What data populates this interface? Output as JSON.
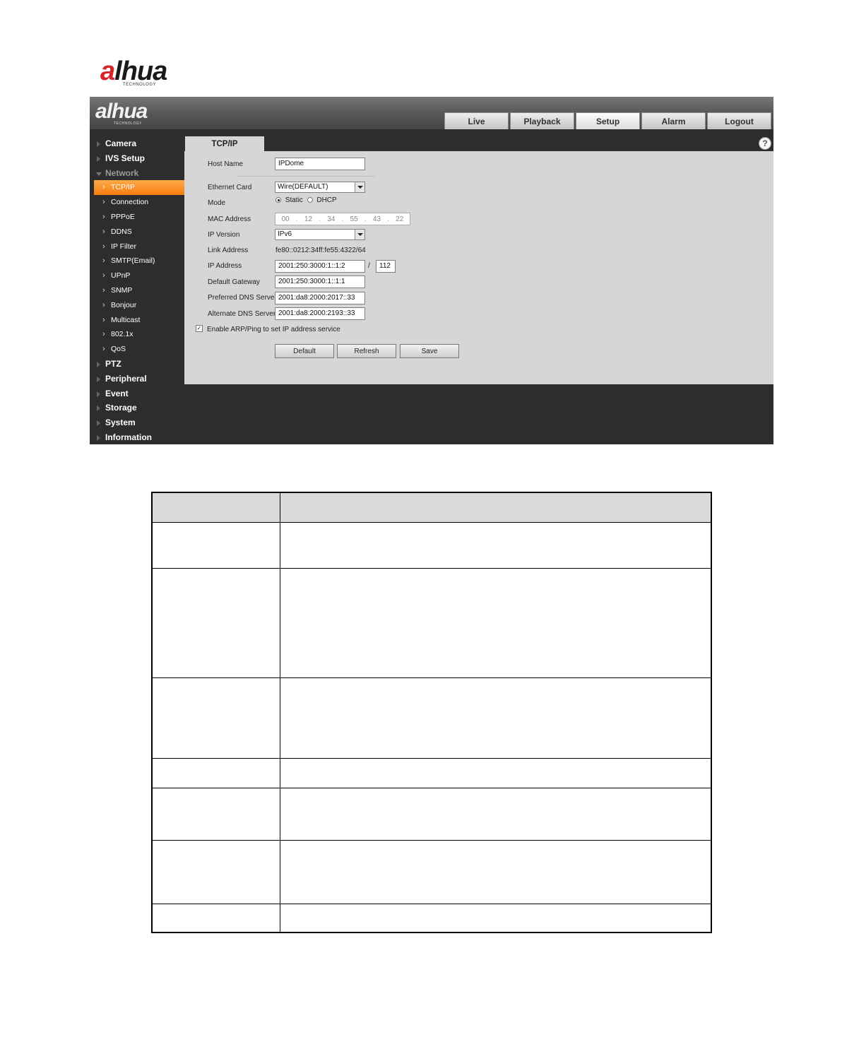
{
  "brand": {
    "name_prefix": "a",
    "name_rest": "lhua",
    "sub": "TECHNOLOGY"
  },
  "top_nav": {
    "tabs": [
      {
        "label": "Live"
      },
      {
        "label": "Playback"
      },
      {
        "label": "Setup"
      },
      {
        "label": "Alarm"
      },
      {
        "label": "Logout"
      }
    ],
    "active": "Setup"
  },
  "sidebar": {
    "items": [
      {
        "label": "Camera"
      },
      {
        "label": "IVS Setup"
      },
      {
        "label": "Network"
      },
      {
        "label": "PTZ"
      },
      {
        "label": "Peripheral"
      },
      {
        "label": "Event"
      },
      {
        "label": "Storage"
      },
      {
        "label": "System"
      },
      {
        "label": "Information"
      }
    ],
    "network_sub": [
      {
        "label": "TCP/IP"
      },
      {
        "label": "Connection"
      },
      {
        "label": "PPPoE"
      },
      {
        "label": "DDNS"
      },
      {
        "label": "IP Filter"
      },
      {
        "label": "SMTP(Email)"
      },
      {
        "label": "UPnP"
      },
      {
        "label": "SNMP"
      },
      {
        "label": "Bonjour"
      },
      {
        "label": "Multicast"
      },
      {
        "label": "802.1x"
      },
      {
        "label": "QoS"
      }
    ]
  },
  "content": {
    "tab": "TCP/IP",
    "help": "?",
    "form": {
      "host_name_label": "Host Name",
      "host_name_value": "IPDome",
      "ethernet_card_label": "Ethernet Card",
      "ethernet_card_value": "Wire(DEFAULT)",
      "mode_label": "Mode",
      "mode_static": "Static",
      "mode_dhcp": "DHCP",
      "mac_label": "MAC Address",
      "mac_parts": [
        "00",
        "12",
        "34",
        "55",
        "43",
        "22"
      ],
      "ip_version_label": "IP Version",
      "ip_version_value": "IPv6",
      "link_address_label": "Link Address",
      "link_address_value": "fe80::0212:34ff:fe55:4322/64",
      "ip_address_label": "IP Address",
      "ip_address_value": "2001:250:3000:1::1:2",
      "prefix_sep": "/",
      "prefix_value": "112",
      "gateway_label": "Default Gateway",
      "gateway_value": "2001:250:3000:1::1:1",
      "pref_dns_label": "Preferred DNS Server",
      "pref_dns_value": "2001:da8:2000:2017::33",
      "alt_dns_label": "Alternate DNS Server",
      "alt_dns_value": "2001:da8:2000:2193::33",
      "arp_label": "Enable ARP/Ping to set IP address service",
      "arp_check": "✓"
    },
    "buttons": {
      "default": "Default",
      "refresh": "Refresh",
      "save": "Save"
    }
  },
  "mac_sep": "."
}
